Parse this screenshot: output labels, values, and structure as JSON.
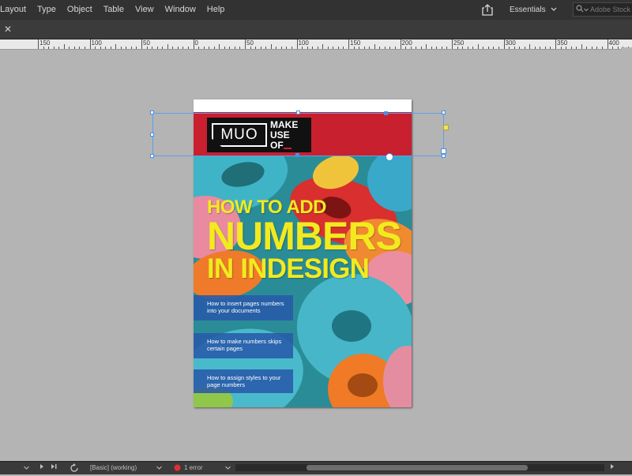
{
  "menu": {
    "items": [
      "Layout",
      "Type",
      "Object",
      "Table",
      "View",
      "Window",
      "Help"
    ]
  },
  "toolbar": {
    "workspace_label": "Essentials",
    "search_placeholder": "Adobe Stock"
  },
  "tab": {
    "close_symbol": "✕"
  },
  "ruler": {
    "labels": [
      "150",
      "100",
      "50",
      "0",
      "50",
      "100",
      "150",
      "200",
      "250",
      "300",
      "350",
      "400"
    ]
  },
  "document": {
    "logo_text": "MUO",
    "logo_make": "MAKE",
    "logo_use": "USE",
    "logo_of": "OF",
    "headline_line1": "HOW TO ADD",
    "headline_line2": "NUMBERS",
    "headline_line3": "IN INDESIGN",
    "toc": [
      "How to insert pages numbers into your documents",
      "How to make numbers skips certain pages",
      "How to assign styles to your page numbers"
    ]
  },
  "status": {
    "page_style": "[Basic] (working)",
    "preflight": "1 error"
  },
  "colors": {
    "accent_red": "#c8202f",
    "headline_yellow": "#f2ea1f",
    "selection_blue": "#4a90e2"
  }
}
